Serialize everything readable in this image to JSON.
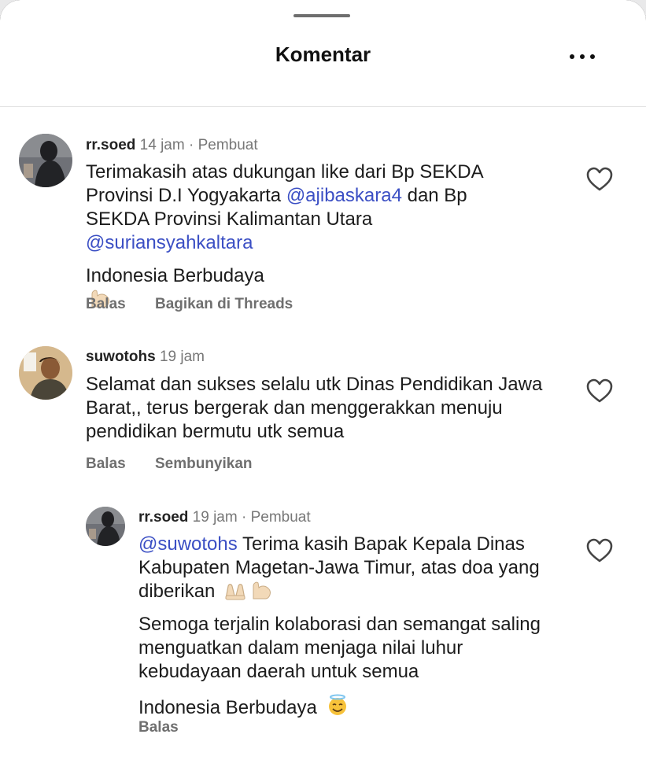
{
  "header": {
    "title": "Komentar",
    "more_icon": "more-horizontal-icon"
  },
  "comments": [
    {
      "username": "rr.soed",
      "time": "14 jam",
      "separator": "·",
      "badge": "Pembuat",
      "text_lines": {
        "p1_a": "Terimakasih atas dukungan like dari Bp SEKDA Provinsi D.I Yogyakarta ",
        "mention1": "@ajibaskara4",
        "p1_b": " dan Bp SEKDA Provinsi Kalimantan Utara ",
        "mention2": "@suriansyahkaltara",
        "p2": "Indonesia Berbudaya"
      },
      "emojis": [
        "indonesia-flag-icon",
        "flexed-biceps-icon"
      ],
      "actions": [
        "Balas",
        "Bagikan di Threads"
      ],
      "like_icon": "heart-outline-icon"
    },
    {
      "username": "suwotohs",
      "time": "19 jam",
      "text": "Selamat dan sukses selalu utk Dinas Pendidikan Jawa Barat,, terus bergerak dan menggerakkan menuju pendidikan bermutu utk semua",
      "actions": [
        "Balas",
        "Sembunyikan"
      ],
      "like_icon": "heart-outline-icon"
    },
    {
      "username": "rr.soed",
      "time": "19 jam",
      "separator": "·",
      "badge": "Pembuat",
      "mention": "@suwotohs",
      "p1": " Terima kasih Bapak Kepala Dinas Kabupaten Magetan-Jawa Timur, atas doa yang diberikan",
      "p2": "Semoga terjalin kolaborasi dan semangat saling menguatkan dalam menjaga nilai luhur kebudayaan daerah untuk semua",
      "p3": "Indonesia Berbudaya",
      "emojis": [
        "folded-hands-icon",
        "flexed-biceps-icon",
        "smiling-face-with-halo-icon",
        "indonesia-flag-icon"
      ],
      "actions": [
        "Balas"
      ],
      "like_icon": "heart-outline-icon"
    }
  ],
  "colors": {
    "mention": "#3b4fc4",
    "meta": "#777777",
    "action": "#6f6f6f"
  }
}
